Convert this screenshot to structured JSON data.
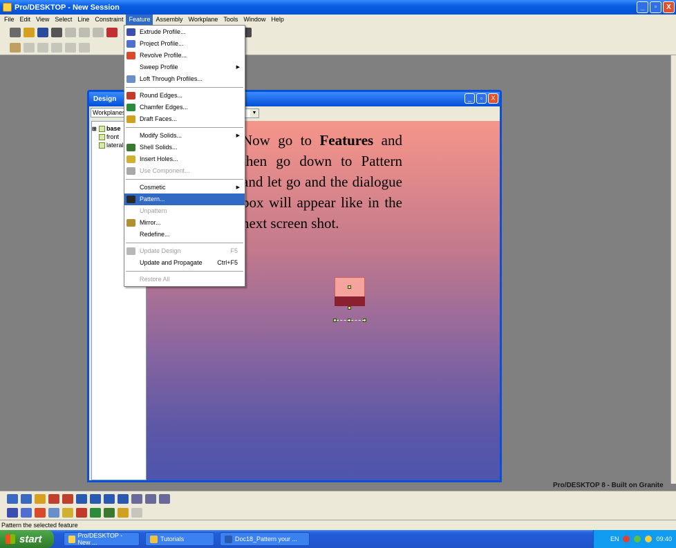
{
  "window": {
    "title": "Pro/DESKTOP - New Session",
    "buttons": [
      "_",
      "▫",
      "X"
    ]
  },
  "menubar": [
    "File",
    "Edit",
    "View",
    "Select",
    "Line",
    "Constraint",
    "Feature",
    "Assembly",
    "Workplane",
    "Tools",
    "Window",
    "Help"
  ],
  "feature_menu": [
    {
      "label": "Extrude Profile...",
      "icon_color": "#3a4fb0"
    },
    {
      "label": "Project Profile...",
      "icon_color": "#4f6fd0"
    },
    {
      "label": "Revolve Profile...",
      "icon_color": "#d84a2a"
    },
    {
      "label": "Sweep Profile",
      "submenu": true
    },
    {
      "label": "Loft Through Profiles...",
      "icon_color": "#6a8ec8"
    },
    {
      "sep": true
    },
    {
      "label": "Round Edges...",
      "icon_color": "#c43a2a"
    },
    {
      "label": "Chamfer Edges...",
      "icon_color": "#2a8c3a"
    },
    {
      "label": "Draft Faces...",
      "icon_color": "#d0a020"
    },
    {
      "sep": true
    },
    {
      "label": "Modify Solids...",
      "submenu": true
    },
    {
      "label": "Shell Solids...",
      "icon_color": "#3a7a30"
    },
    {
      "label": "Insert Holes...",
      "icon_color": "#d0b030"
    },
    {
      "label": "Use Component...",
      "disabled": true,
      "icon_color": "#a8a8a8"
    },
    {
      "sep": true
    },
    {
      "label": "Cosmetic",
      "submenu": true
    },
    {
      "label": "Pattern...",
      "selected": true,
      "icon_color": "#2a2a2a"
    },
    {
      "label": "Unpattern",
      "disabled": true
    },
    {
      "label": "Mirror...",
      "icon_color": "#b09030"
    },
    {
      "label": "Redefine..."
    },
    {
      "sep": true
    },
    {
      "label": "Update Design",
      "disabled": true,
      "accel": "F5",
      "icon_color": "#b8b8b8"
    },
    {
      "label": "Update and Propagate",
      "accel": "Ctrl+F5"
    },
    {
      "sep": true
    },
    {
      "label": "Restore All",
      "disabled": true
    }
  ],
  "design_window": {
    "title": "Design",
    "tab": "Workplanes",
    "tree": [
      "base",
      "front",
      "lateral"
    ]
  },
  "overlay": {
    "prefix": "Now go to ",
    "bold": "Features",
    "suffix": " and then go down to Pattern and let go and the dialogue box will appear like in the next screen shot."
  },
  "watermark": "Pro/DESKTOP 8 - Built on Granite",
  "status": "Pattern the selected feature",
  "taskbar": {
    "start": "start",
    "tasks": [
      "Pro/DESKTOP - New ...",
      "Tutorials",
      "Doc18_Pattern your ..."
    ],
    "tray": {
      "lang": "EN",
      "time": "09:40"
    }
  }
}
